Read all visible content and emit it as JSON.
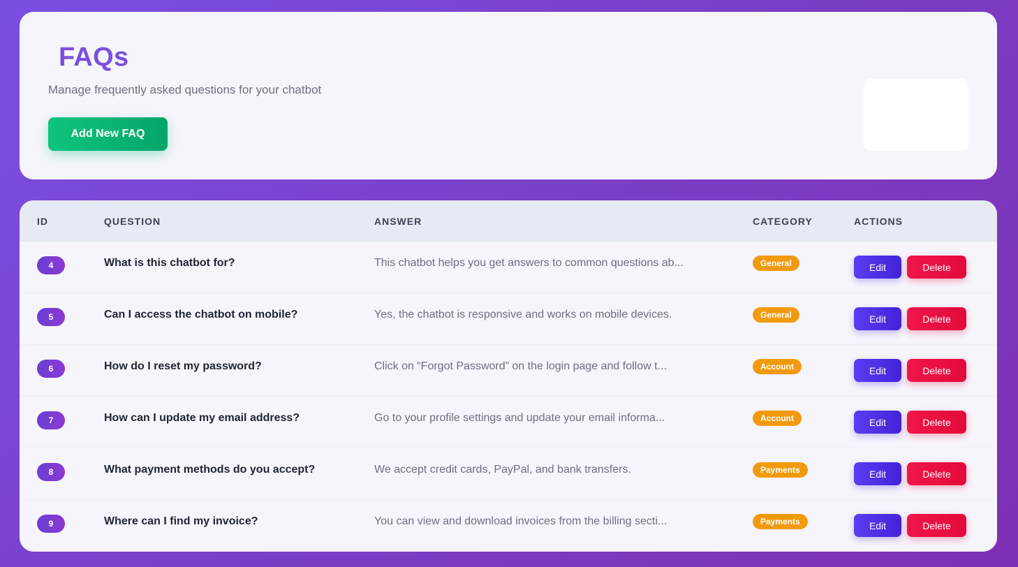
{
  "header": {
    "title": "FAQs",
    "subtitle": "Manage frequently asked questions for your chatbot",
    "add_button_label": "Add New FAQ"
  },
  "table": {
    "columns": {
      "id": "ID",
      "question": "QUESTION",
      "answer": "ANSWER",
      "category": "CATEGORY",
      "actions": "ACTIONS"
    },
    "rows": [
      {
        "id": "4",
        "question": "What is this chatbot for?",
        "answer": "This chatbot helps you get answers to common questions ab...",
        "category": "General",
        "edit_label": "Edit",
        "delete_label": "Delete"
      },
      {
        "id": "5",
        "question": "Can I access the chatbot on mobile?",
        "answer": "Yes, the chatbot is responsive and works on mobile devices.",
        "category": "General",
        "edit_label": "Edit",
        "delete_label": "Delete"
      },
      {
        "id": "6",
        "question": "How do I reset my password?",
        "answer": "Click on “Forgot Password” on the login page and follow t...",
        "category": "Account",
        "edit_label": "Edit",
        "delete_label": "Delete"
      },
      {
        "id": "7",
        "question": "How can I update my email address?",
        "answer": "Go to your profile settings and update your email informa...",
        "category": "Account",
        "edit_label": "Edit",
        "delete_label": "Delete"
      },
      {
        "id": "8",
        "question": "What payment methods do you accept?",
        "answer": "We accept credit cards, PayPal, and bank transfers.",
        "category": "Payments",
        "edit_label": "Edit",
        "delete_label": "Delete"
      },
      {
        "id": "9",
        "question": "Where can I find my invoice?",
        "answer": "You can view and download invoices from the billing secti...",
        "category": "Payments",
        "edit_label": "Edit",
        "delete_label": "Delete"
      }
    ]
  },
  "colors": {
    "title": "#7a4fe0",
    "add_button": "#0fc47d",
    "edit_button": "#5b3cf0",
    "delete_button": "#f0154a",
    "category_badge": "#f29a0e",
    "id_badge": "#6a3ed6"
  }
}
